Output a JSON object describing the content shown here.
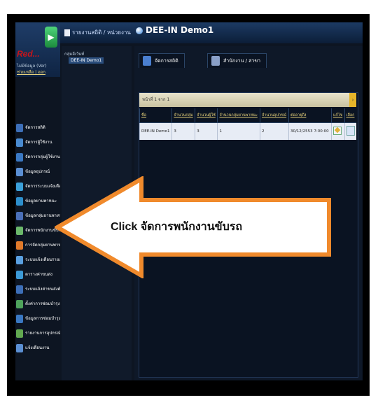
{
  "header": {
    "breadcrumb": "รายงานสถิติ / หน่วยงาน",
    "app_title": "DEE-IN Demo1"
  },
  "logo": {
    "text": "Red...",
    "accent": "#c8141a"
  },
  "user": {
    "line1": "ไม่มีข้อมูล (Ver)",
    "links": "ช่วยเหลือ | ออก"
  },
  "tree": {
    "root": "กลุ่มอีเว้นท์",
    "node": "DEE-IN Demo1"
  },
  "tabs": [
    {
      "label": "จัดการสถิติ",
      "icon": "person-icon"
    },
    {
      "label": "สำนักงาน / สาขา",
      "icon": "printer-icon"
    }
  ],
  "pager": {
    "text": "หน้าที่ 1 จาก 1"
  },
  "grid": {
    "columns": [
      "ชื่อ",
      "จำนวนกลุ่ม",
      "จำนวนผู้ใช้",
      "จำนวนกลุ่มยานพาหนะ",
      "จำนวนอุปกรณ์",
      "ต่ออายุถึง",
      "แก้ไข",
      "เลือก"
    ],
    "rows": [
      [
        "DEE-IN Demo1",
        "3",
        "3",
        "1",
        "2",
        "30/12/2553 7:00:00",
        "",
        ""
      ]
    ]
  },
  "menu": [
    {
      "label": "จัดการสถิติ",
      "color": "#3d6fb8"
    },
    {
      "label": "จัดการผู้ใช้งาน",
      "color": "#4a8bd0"
    },
    {
      "label": "จัดการกลุ่มผู้ใช้งาน",
      "color": "#3a78c2"
    },
    {
      "label": "ข้อมูลอุปกรณ์",
      "color": "#5b8fd3"
    },
    {
      "label": "จัดการระบบแจ้งเตือน",
      "color": "#3ba0d8"
    },
    {
      "label": "ข้อมูลยานพาหนะ",
      "color": "#2d8fcc"
    },
    {
      "label": "ข้อมูลกลุ่มยานพาหนะ",
      "color": "#4a6fb8"
    },
    {
      "label": "จัดการพนักงานขับรถ",
      "color": "#6bb86a"
    },
    {
      "label": "การจัดกลุ่มยานพาหนะ",
      "color": "#e07a2a"
    },
    {
      "label": "ระบบแจ้งเตือนรายงาน",
      "color": "#5aa0e0"
    },
    {
      "label": "ตารางค่าขนส่ง",
      "color": "#3c9ad6"
    },
    {
      "label": "ระบบแจ้งค่าขนส่งต้น",
      "color": "#3d6fb8"
    },
    {
      "label": "ตั้งค่าการซ่อมบำรุง",
      "color": "#4fa35b"
    },
    {
      "label": "ข้อมูลการซ่อมบำรุง",
      "color": "#3a78c2"
    },
    {
      "label": "รายงานการอุปกรณ์",
      "color": "#62a850"
    },
    {
      "label": "แจ้งเตือนงาน",
      "color": "#5b8fd3"
    }
  ],
  "callout": {
    "prefix": "Click",
    "text": "จัดการพนักงานขับรถ",
    "fill": "#ffffff",
    "stroke": "#f08a2c"
  }
}
